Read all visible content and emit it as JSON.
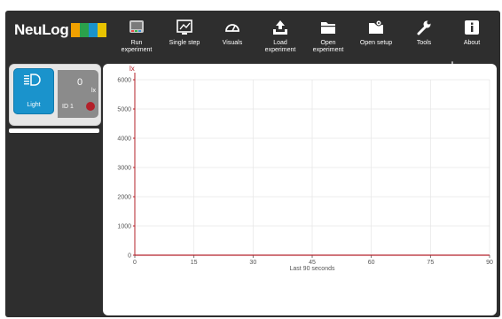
{
  "app": {
    "logo_text": "NeuLog",
    "logo_colors": [
      "#f0a000",
      "#2ba24b",
      "#1a93cc",
      "#e8c300"
    ]
  },
  "toolbar": {
    "items": [
      {
        "label": "Run\nexperiment",
        "icon": "run-experiment-icon"
      },
      {
        "label": "Single step",
        "icon": "single-step-icon"
      },
      {
        "label": "Visuals",
        "icon": "gauge-icon"
      },
      {
        "label": "Load\nexperiment",
        "icon": "upload-icon"
      },
      {
        "label": "Open\nexperiment",
        "icon": "folder-icon"
      },
      {
        "label": "Open setup",
        "icon": "setup-folder-icon"
      },
      {
        "label": "Tools",
        "icon": "wrench-icon"
      },
      {
        "label": "About",
        "icon": "info-icon"
      }
    ]
  },
  "sensor": {
    "name": "Light",
    "value": "0",
    "unit": "lx",
    "id": "ID 1",
    "icon": "light-sensor-icon",
    "status_color": "#b3202a"
  },
  "graph": {
    "ylabel": "lx",
    "xlabel": "Last 90 seconds",
    "y_ticks": [
      "0",
      "1000",
      "2000",
      "3000",
      "4000",
      "5000",
      "6000"
    ],
    "x_ticks": [
      "0",
      "15",
      "30",
      "45",
      "60",
      "75",
      "90"
    ]
  },
  "chart_data": {
    "type": "line",
    "title": "",
    "xlabel": "Last 90 seconds",
    "ylabel": "lx",
    "xlim": [
      0,
      90
    ],
    "ylim": [
      0,
      6000
    ],
    "grid": true,
    "series": [
      {
        "name": "Light",
        "x": [
          0,
          90
        ],
        "y": [
          0,
          0
        ]
      }
    ]
  }
}
